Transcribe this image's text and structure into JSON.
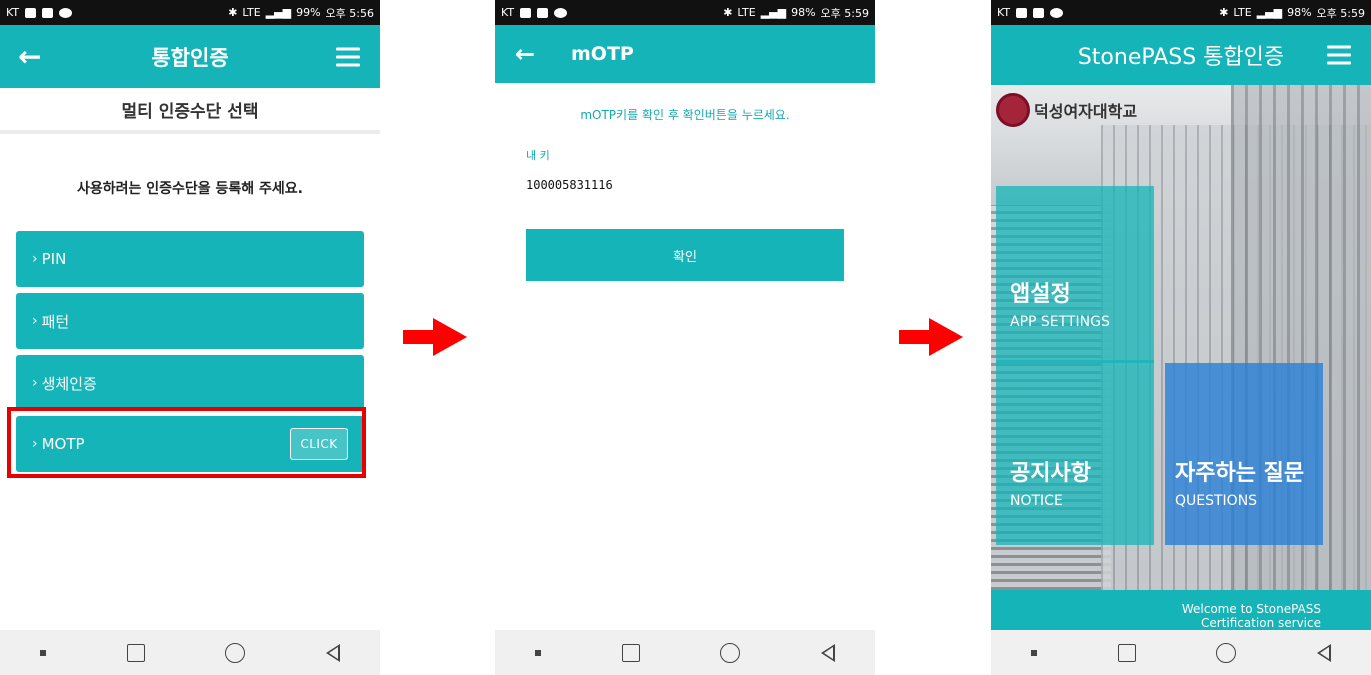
{
  "status_bar": {
    "carrier": "KT",
    "network": "LTE",
    "screens": [
      {
        "battery": "99%",
        "time": "오후 5:56"
      },
      {
        "battery": "98%",
        "time": "오후 5:59"
      },
      {
        "battery": "98%",
        "time": "오후 5:59"
      }
    ]
  },
  "screen1": {
    "title": "통합인증",
    "subheader": "멀티 인증수단 선택",
    "instruction": "사용하려는 인증수단을 등록해 주세요.",
    "methods": [
      {
        "label": "PIN"
      },
      {
        "label": "패턴"
      },
      {
        "label": "생체인증"
      },
      {
        "label": "MOTP",
        "badge": "CLICK"
      }
    ],
    "caret": "›",
    "highlight_color": "#e60000"
  },
  "screen2": {
    "title": "mOTP",
    "instruction": "mOTP키를 확인 후 확인버튼을 누르세요.",
    "key_label": "내 키",
    "key_value": "100005831116",
    "confirm_label": "확인"
  },
  "screen3": {
    "title": "StonePASS 통합인증",
    "logo_text": "덕성여자대학교",
    "tiles": [
      {
        "ko": "앱설정",
        "en": "APP SETTINGS"
      },
      {
        "ko": "공지사항",
        "en": "NOTICE"
      },
      {
        "ko": "자주하는 질문",
        "en": "QUESTIONS"
      }
    ],
    "footer_line1": "Welcome to StonePASS",
    "footer_line2": "Certification service"
  },
  "icons": {
    "back": "←",
    "menu": "hamburger-icon",
    "next": "red-arrow-icon"
  },
  "colors": {
    "accent": "#14b4b8",
    "arrow": "#ff0000",
    "faq_tile": "#2980d7"
  }
}
